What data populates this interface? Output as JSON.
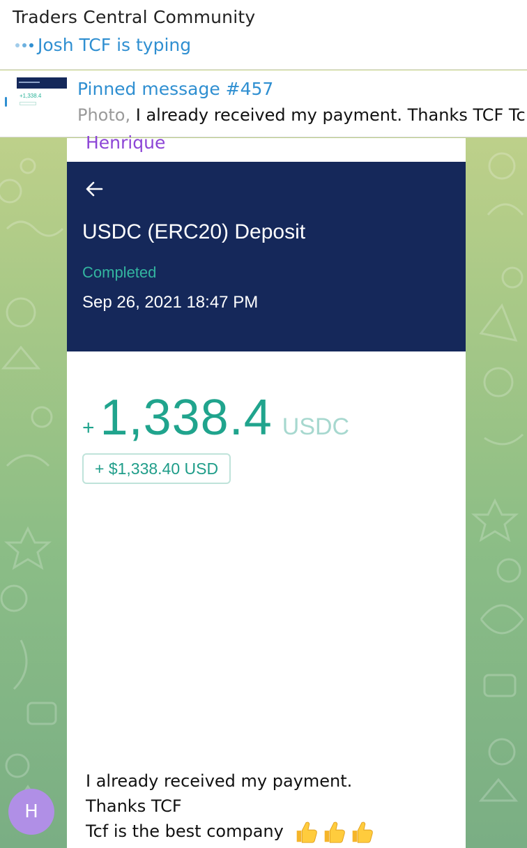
{
  "chat": {
    "title": "Traders Central Community",
    "typing_status": "Josh TCF is typing"
  },
  "pinned": {
    "title": "Pinned message #457",
    "media_label": "Photo,",
    "preview_text": "I already received my payment.  Thanks TCF Tc",
    "thumb_amount": "+1,338.4"
  },
  "message": {
    "sender": "Henrique",
    "screenshot": {
      "title": "USDC (ERC20) Deposit",
      "status": "Completed",
      "date": "Sep 26, 2021 18:47 PM",
      "amount_sign": "+",
      "amount": "1,338.4",
      "currency": "USDC",
      "usd_value": "+ $1,338.40 USD"
    },
    "caption": [
      "I already received my payment.",
      "Thanks TCF",
      "Tcf is the best company"
    ],
    "emoji": "thumbs-up-icon"
  },
  "avatar": {
    "initial": "H",
    "color": "#b08fe6"
  },
  "colors": {
    "accent": "#2f8fd1",
    "sender": "#8c45d6",
    "deposit_header": "#15285a",
    "amount": "#20a48d"
  }
}
